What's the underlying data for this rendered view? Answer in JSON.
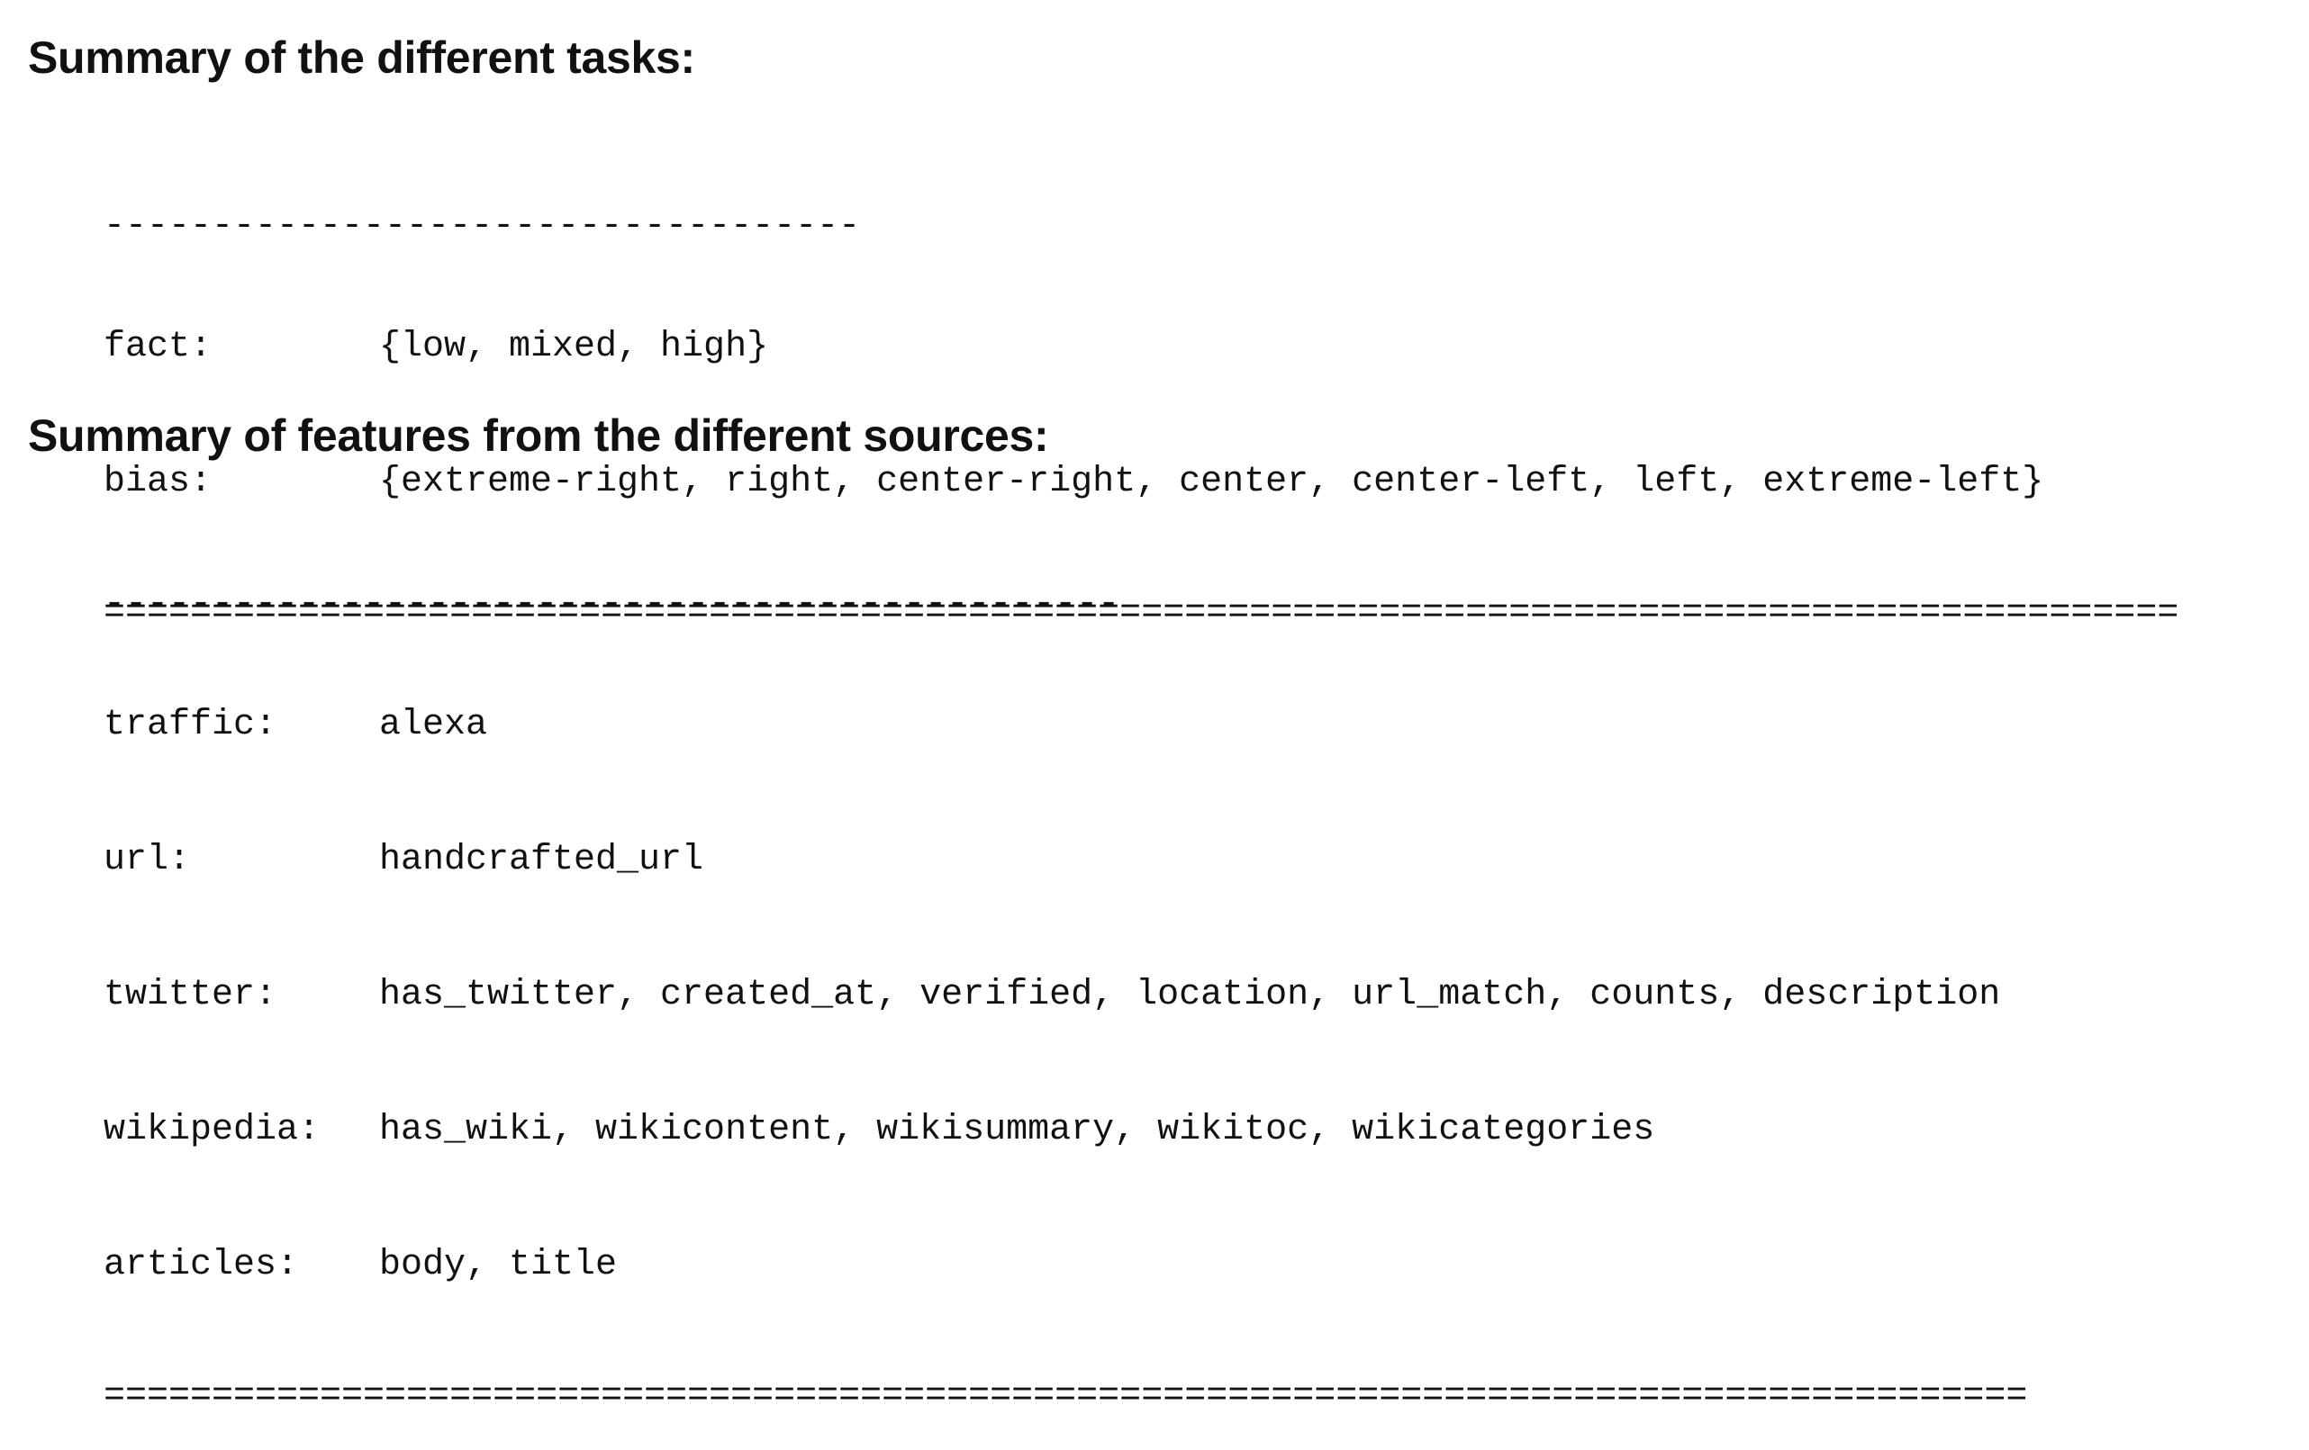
{
  "tasks_section": {
    "heading": "Summary of the different tasks:",
    "top_rule": "-----------------------------------",
    "rows": [
      {
        "key": "fact:",
        "value": "{low, mixed, high}"
      },
      {
        "key": "bias:",
        "value": "{extreme-right, right, center-right, center, center-left, left, extreme-left}"
      }
    ],
    "bottom_rule": "================================================================================================"
  },
  "features_section": {
    "heading": "Summary of features from the different sources:",
    "top_rule": "-----------------------------------------------",
    "rows": [
      {
        "key": "traffic:",
        "value": "alexa"
      },
      {
        "key": "url:",
        "value": "handcrafted_url"
      },
      {
        "key": "twitter:",
        "value": "has_twitter, created_at, verified, location, url_match, counts, description"
      },
      {
        "key": "wikipedia:",
        "value": "has_wiki, wikicontent, wikisummary, wikitoc, wikicategories"
      },
      {
        "key": "articles:",
        "value": "body, title"
      }
    ],
    "bottom_rule": "========================================================================================="
  }
}
